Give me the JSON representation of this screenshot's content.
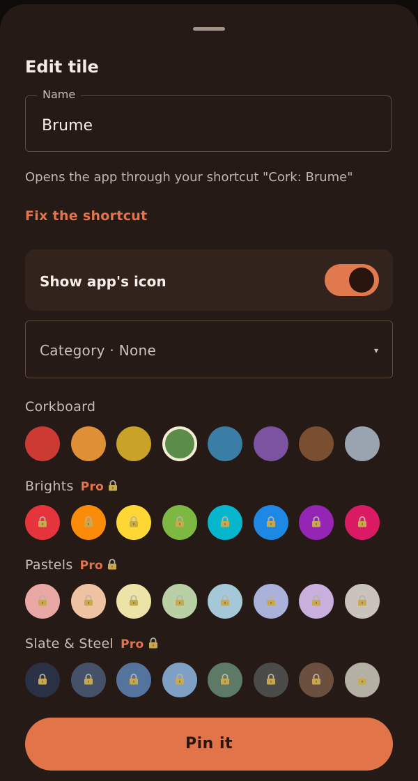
{
  "sheet": {
    "title": "Edit tile",
    "name_field": {
      "label": "Name",
      "value": "Brume"
    },
    "helper_text": "Opens the app through your shortcut \"Cork: Brume\"",
    "fix_link": "Fix the shortcut",
    "show_icon": {
      "label": "Show app's icon",
      "enabled": true
    },
    "category": {
      "text": "Category · None",
      "caret": "▾"
    },
    "pin_button": "Pin it"
  },
  "palettes": [
    {
      "title": "Corkboard",
      "pro": "",
      "locked": false,
      "selected_index": 3,
      "colors": [
        "#cb3a33",
        "#df8f36",
        "#c9a328",
        "#5a8d49",
        "#3a7ea5",
        "#7b53a0",
        "#7a4e30",
        "#9aa4b0"
      ]
    },
    {
      "title": "Brights",
      "pro": "Pro",
      "locked": true,
      "colors": [
        "#e5343c",
        "#fb8c0a",
        "#fdd835",
        "#7cb842",
        "#06b6cc",
        "#1e88e5",
        "#9526b5",
        "#da1b63"
      ]
    },
    {
      "title": "Pastels",
      "pro": "Pro",
      "locked": true,
      "colors": [
        "#e9a8a4",
        "#efc2a4",
        "#ece3a7",
        "#b8d0a4",
        "#a5c8d8",
        "#aab2dc",
        "#c8afdd",
        "#c9c3bc"
      ]
    },
    {
      "title": "Slate & Steel",
      "pro": "Pro",
      "locked": true,
      "colors": [
        "#2a3144",
        "#455169",
        "#54749e",
        "#7fa0c5",
        "#5d7a67",
        "#4b4b4a",
        "#6b5040",
        "#b5b0a4"
      ]
    }
  ],
  "icons": {
    "lock": "lock-icon",
    "dropdown": "chevron-down-icon"
  },
  "colors": {
    "accent": "#e2744a",
    "background": "#251a16",
    "lock_gold": "#c9a94f"
  }
}
